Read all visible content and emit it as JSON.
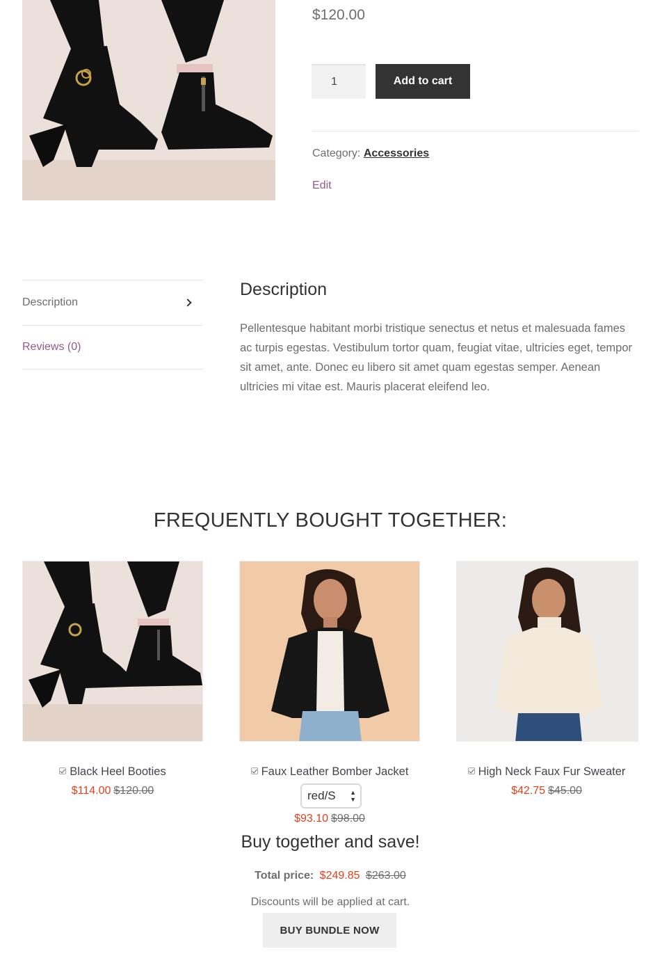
{
  "product": {
    "price": "$120.00",
    "quantity": "1",
    "add_to_cart_label": "Add to cart",
    "category_label": "Category:",
    "category_value": "Accessories",
    "edit_label": "Edit",
    "image_icon": "boots-image"
  },
  "tabs": [
    {
      "label": "Description",
      "active": true
    },
    {
      "label": "Reviews (0)",
      "active": false
    }
  ],
  "description": {
    "title": "Description",
    "body": "Pellentesque habitant morbi tristique senectus et netus et malesuada fames ac turpis egestas. Vestibulum tortor quam, feugiat vitae, ultricies eget, tempor sit amet, ante. Donec eu libero sit amet quam egestas semper. Aenean ultricies mi vitae est. Mauris placerat eleifend leo."
  },
  "bundle": {
    "title": "FREQUENTLY BOUGHT TOGETHER:",
    "items": [
      {
        "name": "Black Heel Booties",
        "sale_price": "$114.00",
        "original_price": "$120.00",
        "checked": true
      },
      {
        "name": "Faux Leather Bomber Jacket",
        "sale_price": "$93.10",
        "original_price": "$98.00",
        "checked": true,
        "variant": "red/S"
      },
      {
        "name": "High Neck Faux Fur Sweater",
        "sale_price": "$42.75",
        "original_price": "$45.00",
        "checked": true
      }
    ],
    "save_title": "Buy together and save!",
    "total_label": "Total price:",
    "total_sale": "$249.85",
    "total_original": "$263.00",
    "discount_note": "Discounts will be applied at cart.",
    "buy_button_label": "BUY BUNDLE NOW"
  },
  "colors": {
    "accent_purple": "#96588a",
    "sale_red": "#e2401c",
    "button_dark": "#333333"
  }
}
